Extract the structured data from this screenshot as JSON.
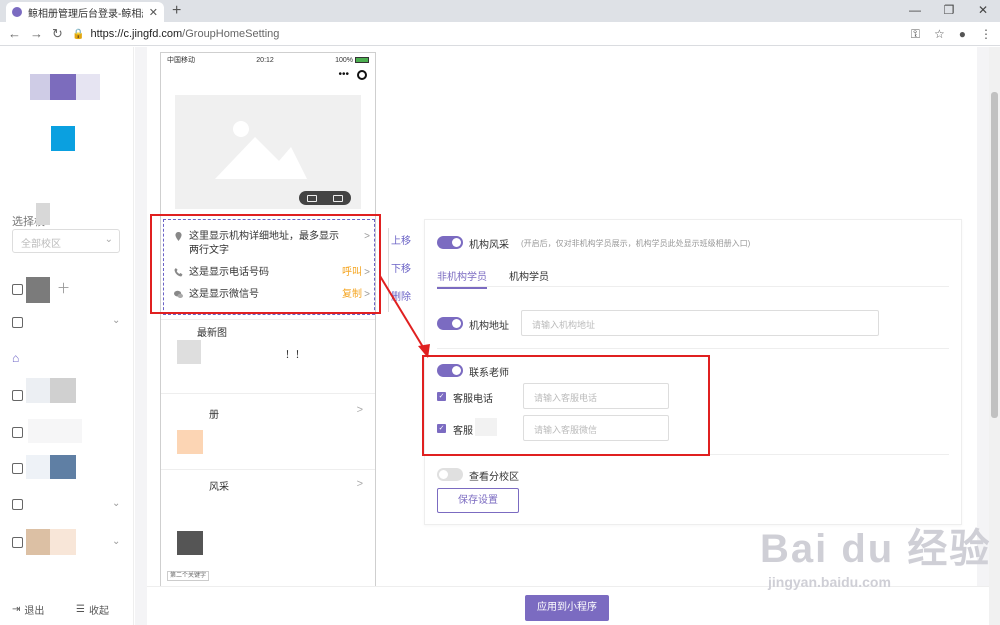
{
  "browser": {
    "tab_title": "鲸相册管理后台登录-鲸相册_会",
    "tab_close": "✕",
    "new_tab": "+",
    "url_domain": "https://c.jingfd.com",
    "url_path": "/GroupHomeSetting",
    "window_controls": [
      "—",
      "❐",
      "✕"
    ]
  },
  "sidebar": {
    "select_label": "选择校",
    "campus_select_value": "全部校区",
    "menu_text_fragment": "十",
    "logout": "退出",
    "collapse": "收起"
  },
  "phone": {
    "carrier": "中国移动",
    "time": "20:12",
    "battery": "100%",
    "menu_dots": "•••",
    "address": "这里显示机构详细地址，最多显示两行文字",
    "phone_text": "这是显示电话号码",
    "phone_action": "呼叫",
    "wechat_text": "这是显示微信号",
    "wechat_action": "复制",
    "row1": "最新图",
    "row2": "！！",
    "row3": "册",
    "row4": "风采",
    "footer1": "第二个关键字",
    "chev": ">"
  },
  "side_ops": {
    "up": "上移",
    "down": "下移",
    "delete": "删除"
  },
  "settings": {
    "style_label": "机构风采",
    "style_hint": "(开启后，仅对非机构学员展示，机构学员此处显示班级相册入口)",
    "tab_non_member": "非机构学员",
    "tab_member": "机构学员",
    "address_label": "机构地址",
    "address_placeholder": "请输入机构地址",
    "contact_label": "联系老师",
    "service_phone_label": "客服电话",
    "service_phone_placeholder": "请输入客服电话",
    "service_wechat_label": "客服",
    "service_wechat_placeholder": "请输入客服微信",
    "branch_label": "查看分校区",
    "save_button": "保存设置",
    "check_mark": "✓"
  },
  "apply_button": "应用到小程序",
  "watermark": {
    "big": "Bai du 经验",
    "small": "jingyan.baidu.com"
  },
  "colors": {
    "accent": "#7b6bc1",
    "annotation_red": "#e02020",
    "action_orange": "#f5a623"
  }
}
